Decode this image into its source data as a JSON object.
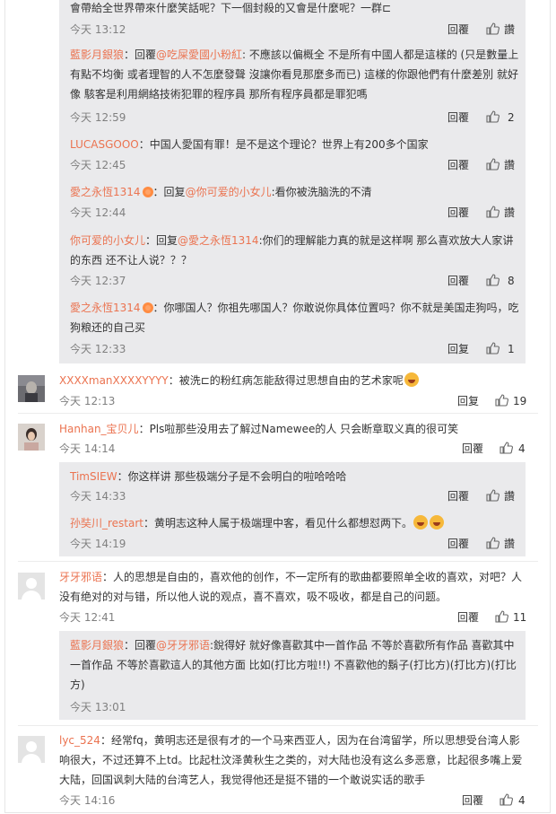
{
  "colors": {
    "name": "#eb7350",
    "text": "#333333",
    "meta": "#808080",
    "sub_bg": "#eaeaec"
  },
  "icons": {
    "like": "thumbs-up-icon",
    "emoji_laugh": "laughing-face-icon",
    "fan_badge": "fan-badge-icon"
  },
  "actions": {
    "reply_trad": "回覆",
    "reply_simp": "回复",
    "like_trad": "讚",
    "like_simp": "赞"
  },
  "comments": [
    {
      "text": "會帶給全世界帶來什麼笑話呢？下一個封殺的又會是什麼呢？一群⊏",
      "time": "今天 13:12",
      "likes": ""
    },
    {
      "name": "藍影月銀狼",
      "reply_prefix": "：回覆",
      "mention": "@吃屎愛國小粉紅",
      "text": ": 不應該以偏概全 不是所有中國人都是這樣的 (只是數量上有點不均衡 或者理智的人不怎麼發聲 沒讓你看見那麼多而已) 這樣的你跟他們有什麼差別 就好像 駭客是利用網絡技術犯罪的程序員 那所有程序員都是罪犯嗎",
      "time": "今天 12:59",
      "likes": "2"
    },
    {
      "name": "LUCASGOOO",
      "text": "：中国人愛国有罪！是不是这个理论？世界上有200多个国家",
      "time": "今天 12:45",
      "likes": ""
    },
    {
      "name": "愛之永恆1314",
      "reply_prefix": "：回复",
      "mention": "@你可爱的小女儿",
      "text": ":看你被洗脑洗的不清",
      "time": "今天 12:44",
      "likes": ""
    },
    {
      "name": "你可爱的小女儿",
      "reply_prefix": "：回复",
      "mention": "@愛之永恆1314",
      "text": ":你们的理解能力真的就是这样啊 那么喜欢放大人家讲的东西 还不让人说？？？",
      "time": "今天 12:37",
      "likes": "8"
    },
    {
      "name": "愛之永恆1314",
      "text": "：你哪国人？你祖先哪国人？你敢说你具体位置吗？你不就是美国走狗吗，吃狗粮还的自己买",
      "time": "今天 12:33",
      "likes": "1"
    },
    {
      "name": "XXXXmanXXXXYYYY",
      "text": "：被洗⊏的粉红病怎能敌得过思想自由的艺术家呢",
      "time": "今天 12:13",
      "likes": "19"
    },
    {
      "name": "Hanhan_宝贝儿",
      "text": "：Pls啦那些没用去了解过Namewee的人 只会断章取义真的很可笑",
      "time": "今天 14:14",
      "likes": "4"
    },
    {
      "name": "TimSIEW",
      "text": "：你这样讲 那些极端分子是不会明白的啦哈哈哈",
      "time": "今天 14:33",
      "likes": ""
    },
    {
      "name": "孙奘川_restart",
      "text": "：黄明志这种人属于极端理中客，看见什么都想怼两下。",
      "time": "今天 14:19",
      "likes": ""
    },
    {
      "name": "牙牙邪语",
      "text": "：人的思想是自由的，喜欢他的创作，不一定所有的歌曲都要照单全收的喜欢，对吧？人没有绝对的对与错，所以他人说的观点，喜不喜欢，吸不吸收，都是自己的问题。",
      "time": "今天 12:41",
      "likes": "11"
    },
    {
      "name": "藍影月銀狼",
      "reply_prefix": "：回覆",
      "mention": "@牙牙邪语",
      "text": ":銳得好 就好像喜歡其中一首作品 不等於喜歡所有作品 喜歡其中一首作品 不等於喜歡這人的其他方面 比如(打比方啦!!) 不喜歡他的鬍子(打比方)(打比方)(打比方)",
      "time": "今天 13:01",
      "likes": ""
    },
    {
      "name": "lyc_524",
      "text": "：经常fq，黄明志还是很有才的一个马来西亚人，因为在台湾留学，所以思想受台湾人影响很大，不过还算不上td。比起杜汶泽黄秋生之类的，对大陆也没有这么多恶意，比起很多嘴上爱大陆，回国讽刺大陆的台湾艺人，我觉得他还是挺不错的一个敢说实话的歌手",
      "time": "今天 14:16",
      "likes": "4"
    }
  ]
}
